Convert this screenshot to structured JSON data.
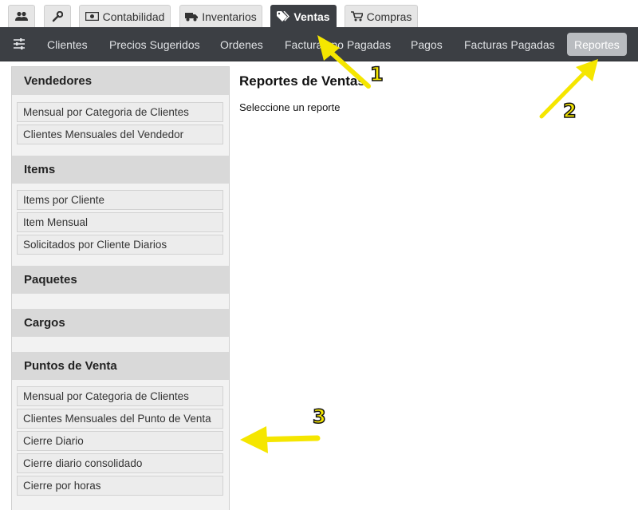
{
  "top_tabs": [
    {
      "label": "",
      "icon": "users-icon"
    },
    {
      "label": "",
      "icon": "wrench-icon"
    },
    {
      "label": "Contabilidad",
      "icon": "money-icon"
    },
    {
      "label": "Inventarios",
      "icon": "truck-icon"
    },
    {
      "label": "Ventas",
      "icon": "tag-icon",
      "active": true
    },
    {
      "label": "Compras",
      "icon": "cart-icon"
    }
  ],
  "nav": {
    "items": [
      "Clientes",
      "Precios Sugeridos",
      "Ordenes",
      "Facturas no Pagadas",
      "Pagos",
      "Facturas Pagadas",
      "Reportes"
    ],
    "active": "Reportes"
  },
  "sidebar": {
    "sections": [
      {
        "title": "Vendedores",
        "items": [
          "Mensual por Categoria de Clientes",
          "Clientes Mensuales del Vendedor"
        ]
      },
      {
        "title": "Items",
        "items": [
          "Items por Cliente",
          "Item Mensual",
          "Solicitados por Cliente Diarios"
        ]
      },
      {
        "title": "Paquetes",
        "items": []
      },
      {
        "title": "Cargos",
        "items": []
      },
      {
        "title": "Puntos de Venta",
        "items": [
          "Mensual por Categoria de Clientes",
          "Clientes Mensuales del Punto de Venta",
          "Cierre Diario",
          "Cierre diario consolidado",
          "Cierre por horas"
        ]
      }
    ]
  },
  "main": {
    "title": "Reportes de Ventas",
    "subtitle": "Seleccione un reporte"
  },
  "annotations": {
    "numbers": [
      "1",
      "2",
      "3"
    ],
    "color": "#f5e600"
  },
  "colors": {
    "navbar": "#3c3f44",
    "active_nav": "#b9bcc0",
    "section_header": "#d9d9d9"
  }
}
